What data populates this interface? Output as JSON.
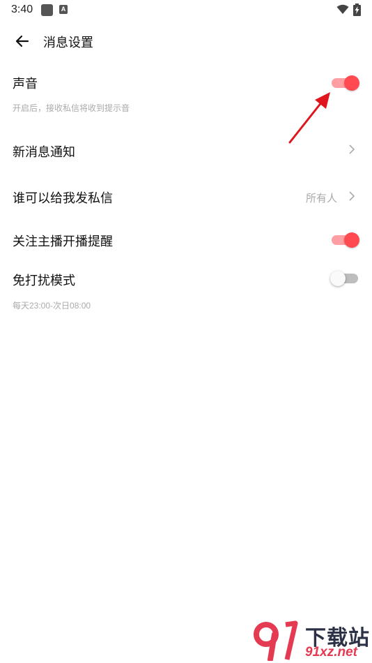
{
  "status_bar": {
    "time": "3:40",
    "notif_icon_letter": "A"
  },
  "header": {
    "title": "消息设置"
  },
  "settings": {
    "sound": {
      "label": "声音",
      "desc": "开启后，接收私信将收到提示音",
      "enabled": true
    },
    "new_message_notify": {
      "label": "新消息通知"
    },
    "who_can_message": {
      "label": "谁可以给我发私信",
      "value": "所有人"
    },
    "follow_live_remind": {
      "label": "关注主播开播提醒",
      "enabled": true
    },
    "do_not_disturb": {
      "label": "免打扰模式",
      "desc": "每天23:00-次日08:00",
      "enabled": false
    }
  },
  "watermark": {
    "title": "下载站",
    "url": "91xz.net"
  },
  "colors": {
    "accent": "#ff4a52",
    "accent_light": "#ff9fa3",
    "annotation_arrow": "#e0161f"
  }
}
